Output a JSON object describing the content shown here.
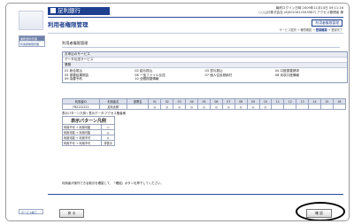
{
  "header": {
    "logo_text": "足利銀行",
    "user_line1": "最終ログイン日時 2009年11月10日 09:11:16",
    "user_line2": "○○山口株式会社 (8)0021612345987) アクセス管理者 様",
    "page_title": "利用者権限管理",
    "badge": "利用者権限管理",
    "steps": [
      "サービス選択",
      "権限確認",
      "登録確認",
      "登録完了"
    ],
    "active_step": "登録確認"
  },
  "sidebar": {
    "header": "業務選択/管理",
    "items": [
      "利用者権限管理"
    ],
    "bottom_link": "サービス終了"
  },
  "main": {
    "section_title": "利用者権限管理",
    "service_header": "お申込のサービス",
    "service_name": "データ伝送サービス",
    "category": "業務",
    "services": [
      "01 総合振込",
      "02 給与振込",
      "03 賞与振込",
      "04 口座振替請求",
      "05 振替結果照会",
      "06 一括ファイル伝送",
      "07 個人住民税納付",
      "08 未収口座情報",
      "09 為替予約",
      "10 全銀振替情報",
      "",
      ""
    ],
    "table": {
      "headers": [
        "利用者ID",
        "利用者名",
        "部署名",
        "01",
        "02",
        "03",
        "04",
        "05",
        "06",
        "07",
        "08",
        "09",
        "10",
        "11",
        "12",
        "13",
        "14",
        "15",
        "16"
      ],
      "row": [
        "FB2222222",
        "足利太郎",
        "",
        "◎",
        "◎",
        "◎",
        "◎",
        "◎",
        "◎",
        "◎",
        "◎",
        "◎",
        "◎",
        "",
        "",
        "",
        "",
        "",
        ""
      ]
    },
    "note": "表示パターン凡例 / 表示データ:アクセス権者様",
    "legend": {
      "title": "表示パターン凡例",
      "rows": [
        {
          "label": "利用不可 → 利用可能",
          "sym": "○"
        },
        {
          "label": "利用可能 → 利用可能",
          "sym": "◎"
        },
        {
          "label": "利用可能 → 利用不可",
          "sym": "×"
        },
        {
          "label": "利用不可 → 利用不可",
          "sym": "非表示"
        }
      ]
    },
    "footer_text": "利用者が操作できる取引を確認して、「確認」ボタンを押下してください。"
  },
  "buttons": {
    "back": "戻 る",
    "confirm": "確 認"
  }
}
